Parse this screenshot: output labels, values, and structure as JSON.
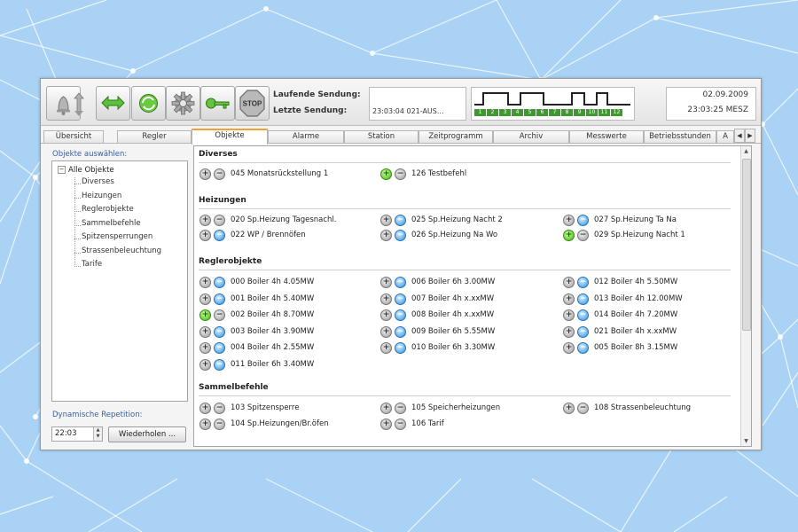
{
  "toolbar": {
    "buttons": [
      {
        "icon": "bell-icon"
      },
      {
        "icon": "up-down-arrows-icon"
      },
      {
        "icon": "swap-arrows-icon"
      },
      {
        "icon": "refresh-icon"
      },
      {
        "icon": "gear-icon"
      },
      {
        "icon": "key-icon"
      },
      {
        "icon": "stop-icon",
        "label": "STOP"
      }
    ],
    "current_send_label": "Laufende Sendung:",
    "last_send_label": "Letzte Sendung:",
    "last_send_value": "23:03:04   021-AUS...",
    "channels": [
      "1",
      "2",
      "3",
      "4",
      "5",
      "6",
      "7",
      "8",
      "9",
      "10",
      "11",
      "12"
    ],
    "date": "02.09.2009",
    "time": "23:03:25 MESZ",
    "colors": {
      "channel": "#3e9a2e",
      "accent_tab": "#f0a430"
    }
  },
  "tabs": [
    {
      "label": "Übersicht"
    },
    {
      "label": "Regler"
    },
    {
      "label": "Objekte",
      "active": true
    },
    {
      "label": "Alarme"
    },
    {
      "label": "Station"
    },
    {
      "label": "Zeitprogramm"
    },
    {
      "label": "Archiv"
    },
    {
      "label": "Messwerte"
    },
    {
      "label": "Betriebsstunden"
    },
    {
      "label": "A"
    }
  ],
  "left": {
    "title": "Objekte auswählen:",
    "tree_root": "Alle Objekte",
    "tree_items": [
      "Diverses",
      "Heizungen",
      "Reglerobjekte",
      "Sammelbefehle",
      "Spitzensperrungen",
      "Strassenbeleuchtung",
      "Tarife"
    ],
    "repetition_title": "Dynamische Repetition:",
    "repetition_time": "22:03",
    "repeat_button": "Wiederholen ..."
  },
  "main": {
    "sections": [
      {
        "title": "Diverses",
        "items": [
          {
            "label": "045 Monatsrückstellung 1",
            "on": "grey",
            "off": "grey"
          },
          {
            "label": "126 Testbefehl",
            "on": "green",
            "off": "grey"
          }
        ]
      },
      {
        "title": "Heizungen",
        "items": [
          {
            "label": "020 Sp.Heizung Tagesnachl.",
            "on": "grey",
            "off": "grey"
          },
          {
            "label": "025 Sp.Heizung Nacht 2",
            "on": "grey",
            "off": "blue"
          },
          {
            "label": "027 Sp.Heizung Ta Na",
            "on": "grey",
            "off": "blue"
          },
          {
            "label": "022 WP / Brennöfen",
            "on": "grey",
            "off": "blue"
          },
          {
            "label": "026 Sp.Heizung Na Wo",
            "on": "grey",
            "off": "blue"
          },
          {
            "label": "029 Sp.Heizung Nacht 1",
            "on": "green",
            "off": "grey"
          }
        ]
      },
      {
        "title": "Reglerobjekte",
        "items": [
          {
            "label": "000 Boiler 4h 4.05MW",
            "on": "grey",
            "off": "blue"
          },
          {
            "label": "006 Boiler 6h 3.00MW",
            "on": "grey",
            "off": "blue"
          },
          {
            "label": "012 Boiler 4h 5.50MW",
            "on": "grey",
            "off": "blue"
          },
          {
            "label": "001 Boiler 4h 5.40MW",
            "on": "grey",
            "off": "blue"
          },
          {
            "label": "007 Boiler 4h x.xxMW",
            "on": "grey",
            "off": "blue"
          },
          {
            "label": "013 Boiler 4h 12.00MW",
            "on": "grey",
            "off": "blue"
          },
          {
            "label": "002 Boiler 4h 8.70MW",
            "on": "green",
            "off": "grey"
          },
          {
            "label": "008 Boiler 4h x.xxMW",
            "on": "grey",
            "off": "blue"
          },
          {
            "label": "014 Boiler 4h 7.20MW",
            "on": "grey",
            "off": "blue"
          },
          {
            "label": "003 Boiler 4h 3.90MW",
            "on": "grey",
            "off": "blue"
          },
          {
            "label": "009 Boiler 6h 5.55MW",
            "on": "grey",
            "off": "blue"
          },
          {
            "label": "021 Boiler 4h x.xxMW",
            "on": "grey",
            "off": "blue"
          },
          {
            "label": "004 Boiler 4h 2.55MW",
            "on": "grey",
            "off": "blue"
          },
          {
            "label": "010 Boiler 6h 3.30MW",
            "on": "grey",
            "off": "blue"
          },
          {
            "label": "005 Boiler 8h 3.15MW",
            "on": "grey",
            "off": "blue"
          },
          {
            "label": "011 Boiler 6h 3.40MW",
            "on": "grey",
            "off": "blue"
          }
        ]
      },
      {
        "title": "Sammelbefehle",
        "items": [
          {
            "label": "103 Spitzensperre",
            "on": "grey",
            "off": "grey"
          },
          {
            "label": "105 Speicherheizungen",
            "on": "grey",
            "off": "grey"
          },
          {
            "label": "108 Strassenbeleuchtung",
            "on": "grey",
            "off": "grey"
          },
          {
            "label": "104 Sp.Heizungen/Br.öfen",
            "on": "grey",
            "off": "grey"
          },
          {
            "label": "106 Tarif",
            "on": "grey",
            "off": "grey"
          }
        ]
      }
    ]
  }
}
